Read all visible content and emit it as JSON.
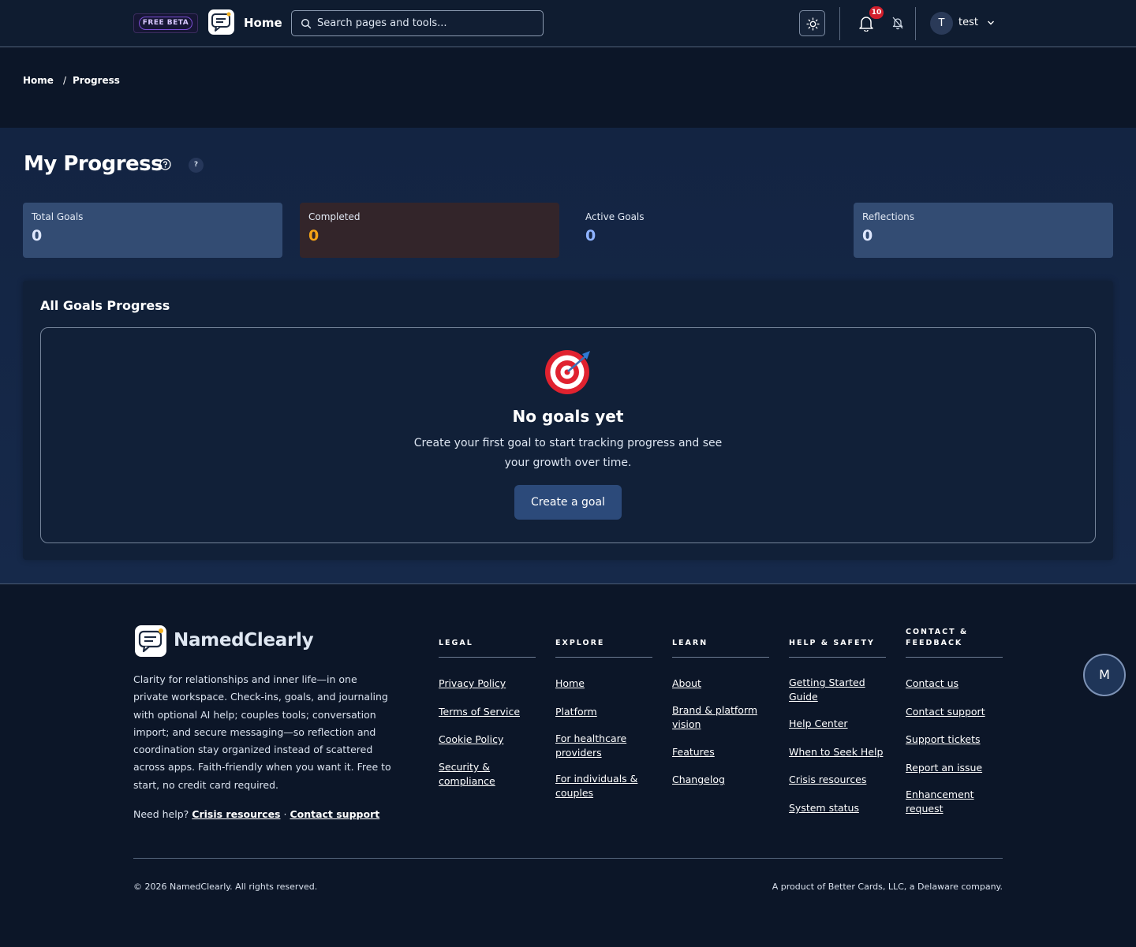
{
  "header": {
    "badge": "FREE BETA",
    "home_label": "Home",
    "search_placeholder": "Search pages and tools...",
    "notification_count": "10",
    "user_initial": "T",
    "user_name": "test"
  },
  "breadcrumb": {
    "home": "Home",
    "separator": "/",
    "current": "Progress"
  },
  "page": {
    "title": "My Progress",
    "help_badge": "?"
  },
  "stats": [
    {
      "label": "Total Goals",
      "value": "0",
      "value_color": "#dfe8ff",
      "bg": "#334c73"
    },
    {
      "label": "Completed",
      "value": "0",
      "value_color": "#f4a316",
      "bg": "#33252a"
    },
    {
      "label": "Active Goals",
      "value": "0",
      "value_color": "#8fb3ff",
      "bg": "transparent"
    },
    {
      "label": "Reflections",
      "value": "0",
      "value_color": "#dfe8ff",
      "bg": "#334c73"
    }
  ],
  "goals_panel": {
    "title": "All Goals Progress",
    "empty_title": "No goals yet",
    "empty_desc": "Create your first goal to start tracking progress and see your growth over time.",
    "create_button": "Create a goal"
  },
  "footer": {
    "brand": "NamedClearly",
    "description": "Clarity for relationships and inner life—in one private workspace. Check-ins, goals, and journaling with optional AI help; couples tools; conversation import; and secure messaging—so reflection and coordination stay organized instead of scattered across apps. Faith-friendly when you want it. Free to start, no credit card required.",
    "need_help": "Need help?",
    "crisis_link": "Crisis resources",
    "dot": "·",
    "contact_link": "Contact support",
    "columns": [
      {
        "heading": "LEGAL",
        "links": [
          "Privacy Policy",
          "Terms of Service",
          "Cookie Policy",
          "Security & compliance"
        ]
      },
      {
        "heading": "EXPLORE",
        "links": [
          "Home",
          "Platform",
          "For healthcare providers",
          "For individuals & couples"
        ]
      },
      {
        "heading": "LEARN",
        "links": [
          "About",
          "Brand & platform vision",
          "Features",
          "Changelog"
        ]
      },
      {
        "heading": "HELP & SAFETY",
        "links": [
          "Getting Started Guide",
          "Help Center",
          "When to Seek Help",
          "Crisis resources",
          "System status"
        ]
      },
      {
        "heading": "CONTACT & FEEDBACK",
        "links": [
          "Contact us",
          "Contact support",
          "Support tickets",
          "Report an issue",
          "Enhancement request"
        ]
      }
    ],
    "copyright": "© 2026 NamedClearly. All rights reserved.",
    "product": "A product of Better Cards, LLC, a Delaware company."
  },
  "floating_button": "M"
}
